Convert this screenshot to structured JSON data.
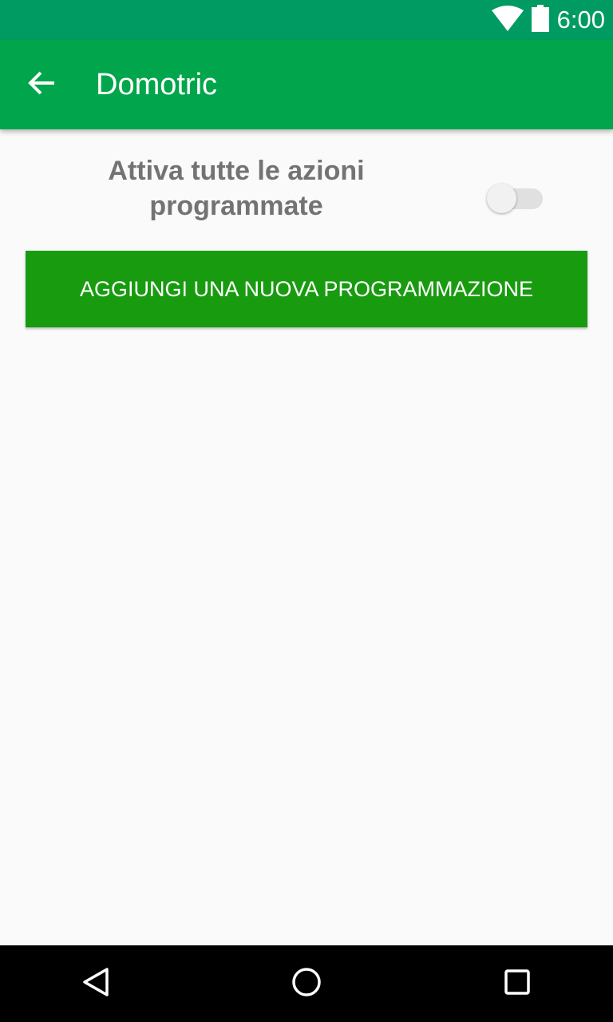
{
  "status_bar": {
    "time": "6:00",
    "icons": [
      "wifi-icon",
      "battery-icon"
    ]
  },
  "app_bar": {
    "title": "Domotric",
    "back_icon": "arrow-back-icon"
  },
  "schedule_switch": {
    "label": "Attiva tutte le azioni programmate",
    "checked": false
  },
  "add_button": {
    "label": "AGGIUNGI UNA NUOVA PROGRAMMAZIONE"
  },
  "nav_bar": {
    "icons": [
      "back-triangle-icon",
      "home-circle-icon",
      "recents-square-icon"
    ]
  },
  "colors": {
    "status_bar": "#009b62",
    "app_bar": "#00a54c",
    "button": "#199b10",
    "label_text": "#737373",
    "background": "#fafafa"
  }
}
